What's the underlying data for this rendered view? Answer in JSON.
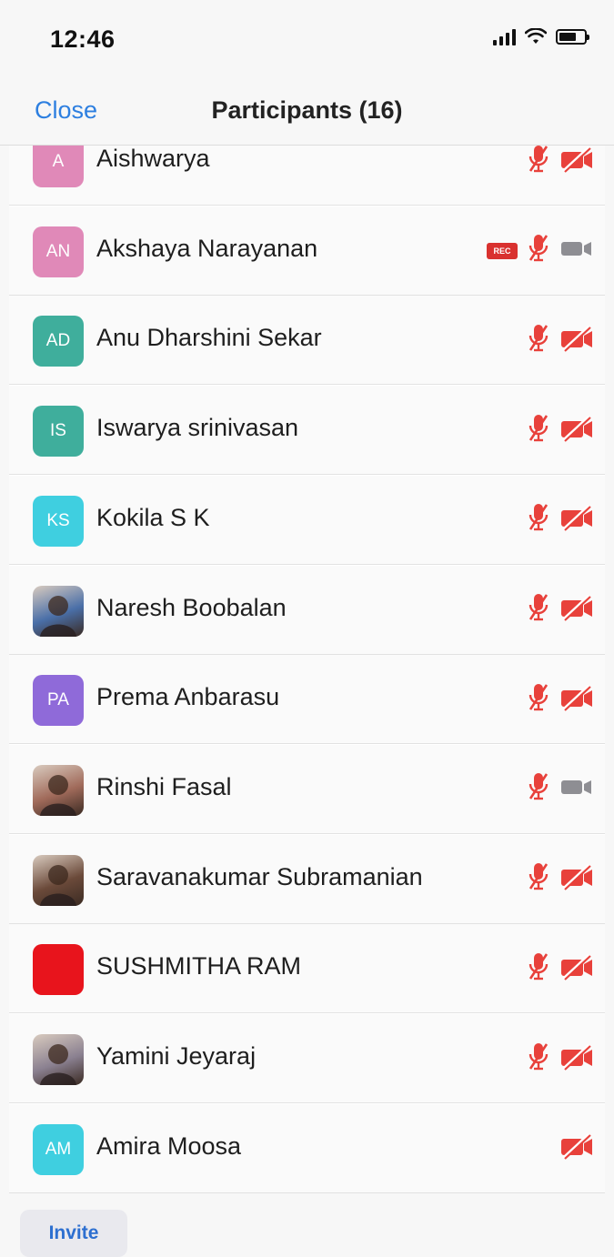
{
  "status_bar": {
    "time": "12:46"
  },
  "nav": {
    "close_label": "Close",
    "title": "Participants (16)"
  },
  "colors": {
    "accent": "#2d7fe0",
    "muted_red": "#e8413b",
    "camera_on_gray": "#8e8e93"
  },
  "participants": [
    {
      "name": "Aishwarya",
      "initials": "A",
      "avatar_color": "#e089b8",
      "avatar_type": "initials",
      "recording": false,
      "audio": "muted",
      "video": "off"
    },
    {
      "name": "Akshaya Narayanan",
      "initials": "AN",
      "avatar_color": "#e089b8",
      "avatar_type": "initials",
      "recording": true,
      "rec_label": "REC",
      "audio": "muted",
      "video": "on"
    },
    {
      "name": "Anu Dharshini Sekar",
      "initials": "AD",
      "avatar_color": "#3fae9c",
      "avatar_type": "initials",
      "recording": false,
      "audio": "muted",
      "video": "off"
    },
    {
      "name": "Iswarya srinivasan",
      "initials": "IS",
      "avatar_color": "#3fae9c",
      "avatar_type": "initials",
      "recording": false,
      "audio": "muted",
      "video": "off"
    },
    {
      "name": "Kokila S K",
      "initials": "KS",
      "avatar_color": "#3fcfe0",
      "avatar_type": "initials",
      "recording": false,
      "audio": "muted",
      "video": "off"
    },
    {
      "name": "Naresh Boobalan",
      "initials": "",
      "avatar_color": "#4a6fa8",
      "avatar_type": "photo",
      "recording": false,
      "audio": "muted",
      "video": "off"
    },
    {
      "name": "Prema Anbarasu",
      "initials": "PA",
      "avatar_color": "#8f6ad9",
      "avatar_type": "initials",
      "recording": false,
      "audio": "muted",
      "video": "off"
    },
    {
      "name": "Rinshi Fasal",
      "initials": "",
      "avatar_color": "#a06a5a",
      "avatar_type": "photo",
      "recording": false,
      "audio": "muted",
      "video": "on"
    },
    {
      "name": "Saravanakumar Subramanian",
      "initials": "",
      "avatar_color": "#6b4a3a",
      "avatar_type": "photo",
      "recording": false,
      "audio": "muted",
      "video": "off"
    },
    {
      "name": "SUSHMITHA RAM",
      "initials": "",
      "avatar_color": "#e8141c",
      "avatar_type": "solid",
      "recording": false,
      "audio": "muted",
      "video": "off"
    },
    {
      "name": "Yamini Jeyaraj",
      "initials": "",
      "avatar_color": "#8a8090",
      "avatar_type": "photo",
      "recording": false,
      "audio": "muted",
      "video": "off"
    },
    {
      "name": "Amira Moosa",
      "initials": "AM",
      "avatar_color": "#3fcfe0",
      "avatar_type": "initials",
      "recording": false,
      "audio": "none",
      "video": "off"
    }
  ],
  "footer": {
    "invite_label": "Invite"
  }
}
